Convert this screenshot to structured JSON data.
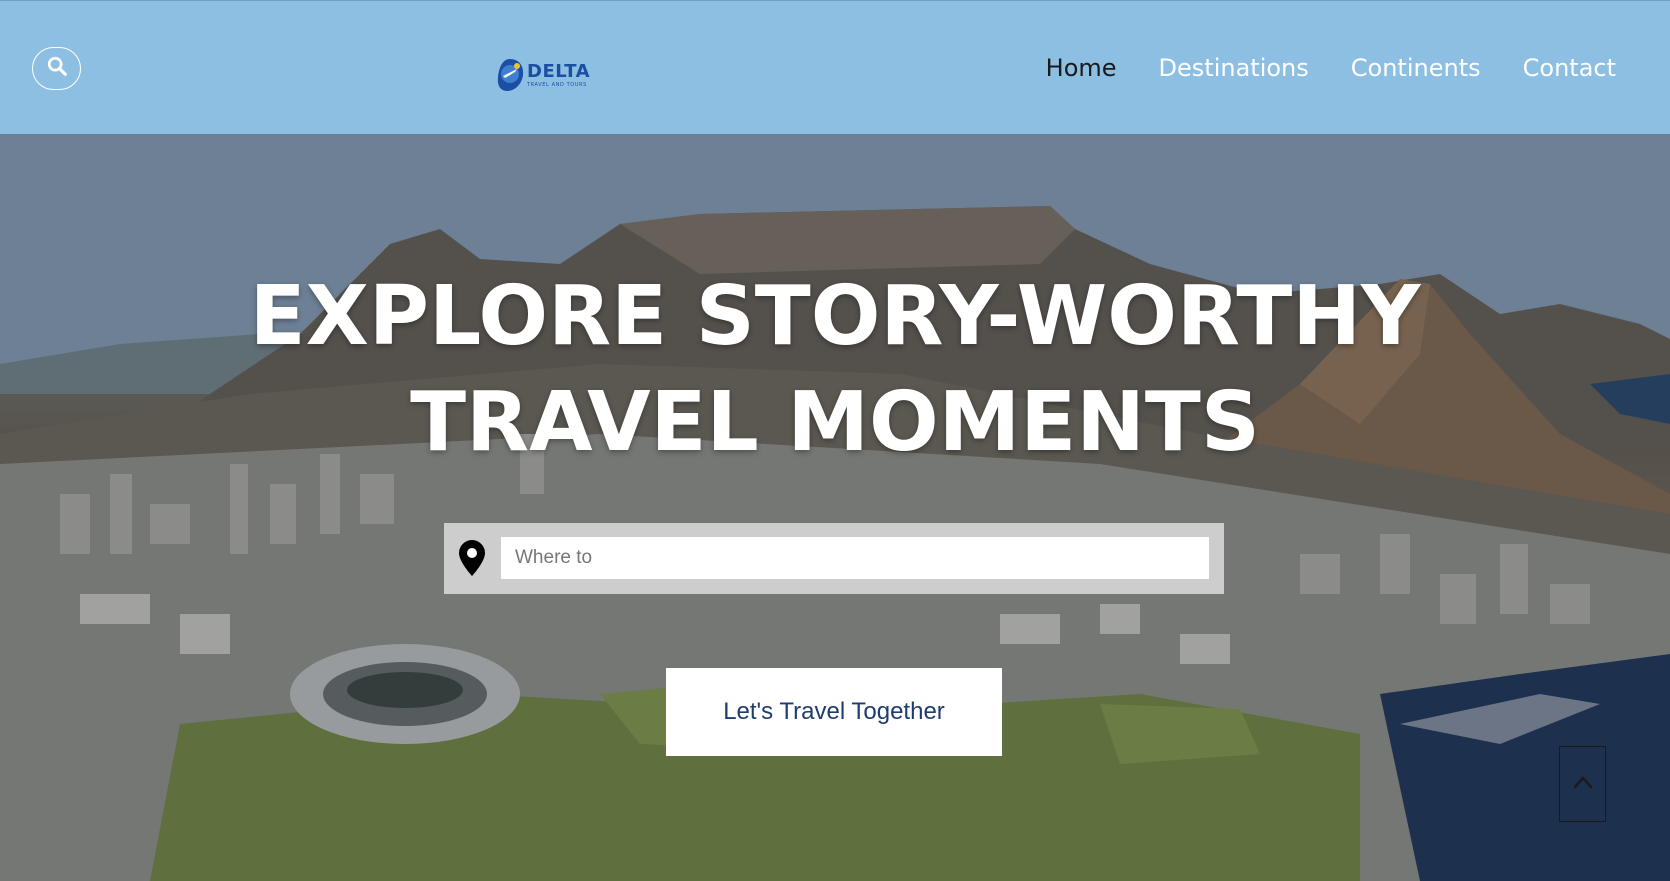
{
  "header": {
    "logo": {
      "name": "DELTA",
      "tagline": "TRAVEL AND TOURS"
    },
    "nav": [
      {
        "label": "Home",
        "active": true
      },
      {
        "label": "Destinations",
        "active": false
      },
      {
        "label": "Continents",
        "active": false
      },
      {
        "label": "Contact",
        "active": false
      }
    ],
    "search_icon": "search-icon"
  },
  "hero": {
    "title_line1": "EXPLORE STORY-WORTHY",
    "title_line2": "TRAVEL MOMENTS",
    "search": {
      "placeholder": "Where to",
      "value": "",
      "icon": "map-pin-icon"
    },
    "cta_label": "Let's Travel Together",
    "scroll_top_icon": "chevron-up-icon",
    "background": "aerial city photo with flat-topped mountain, stadium and coastline"
  },
  "colors": {
    "header_bg": "#8dbfe2",
    "nav_text": "#ffffff",
    "nav_active": "#1a1a1a",
    "logo_blue": "#1b4fa3",
    "cta_text": "#1e3c6e"
  }
}
